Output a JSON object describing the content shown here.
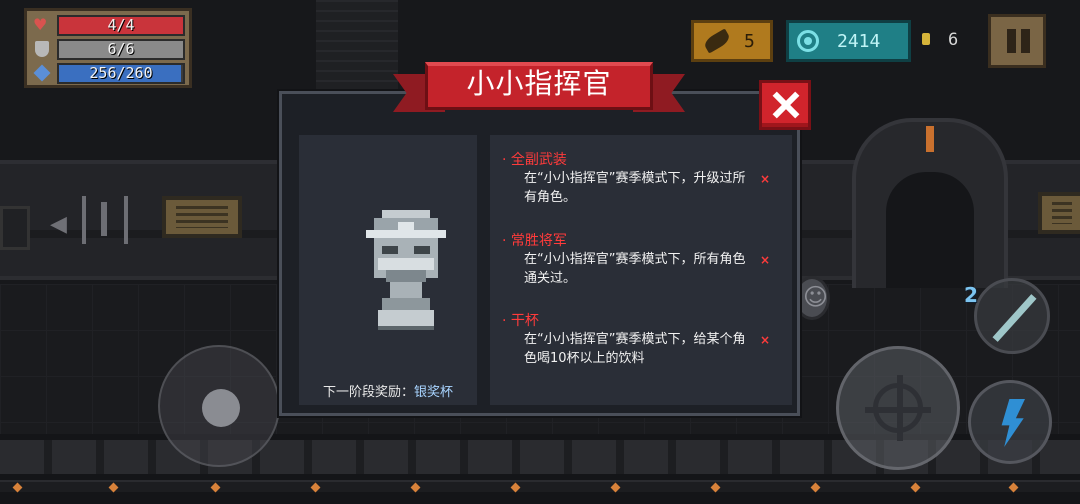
{
  "hud": {
    "hp": {
      "text": "4/4",
      "fraction": 1.0,
      "color": "#c9343b"
    },
    "armor": {
      "text": "6/6",
      "fraction": 1.0,
      "color": "#8a8a8a"
    },
    "energy": {
      "text": "256/260",
      "fraction": 0.985,
      "color": "#3a6fc0"
    },
    "feathers": "5",
    "gems": "2414",
    "coins": "6"
  },
  "dialog": {
    "title": "小小指挥官",
    "reward_label": "下一阶段奖励：",
    "reward_value": "银奖杯",
    "achievements": [
      {
        "title": "全副武装",
        "desc": "在“小小指挥官”赛季模式下，升级过所有角色。",
        "status": "×"
      },
      {
        "title": "常胜将军",
        "desc": "在“小小指挥官”赛季模式下，所有角色通关过。",
        "status": "×"
      },
      {
        "title": "干杯",
        "desc": "在“小小指挥官”赛季模式下，给某个角色喝10杯以上的饮料",
        "status": "×"
      }
    ]
  },
  "weapon_badge": "2",
  "colors": {
    "accent_red": "#ff3b3b",
    "ribbon": "#c4232b",
    "reward_value": "#a8d4ff"
  }
}
